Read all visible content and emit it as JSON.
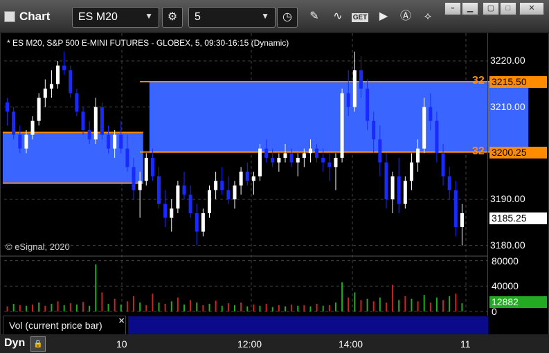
{
  "app": {
    "title": "Chart"
  },
  "toolbar": {
    "symbol": "ES M20",
    "interval": "5",
    "get_label": "GET"
  },
  "chart": {
    "caption": "* ES M20, S&P 500 E-MINI FUTURES - GLOBEX, 5, 09:30-16:15 (Dynamic)",
    "copyright": "© eSignal, 2020",
    "last_price": "3185.25",
    "level_count_label": "32"
  },
  "volume": {
    "legend": "Vol (current price bar)",
    "last_volume": "12882"
  },
  "footer": {
    "mode": "Dyn"
  },
  "colors": {
    "band": "#3a66ff",
    "level_line": "#ff8c00",
    "up": "#ffffff",
    "down": "#1a2aff",
    "vol_up": "#22aa22",
    "vol_down": "#cc2222"
  },
  "chart_data": {
    "type": "candlestick",
    "price_axis": {
      "ticks": [
        3220,
        3210,
        3190,
        3180
      ],
      "tick_labels": [
        "3220.00",
        "3210.00",
        "3190.00",
        "3180.00"
      ],
      "range": [
        3178,
        3226
      ]
    },
    "time_axis": {
      "ticks": [
        "10",
        "12:00",
        "14:00",
        "11"
      ]
    },
    "levels": [
      {
        "value": 3215.5,
        "label": "3215.50",
        "count": "32"
      },
      {
        "value": 3200.25,
        "label": "3200.25",
        "count": "32"
      }
    ],
    "bands": [
      {
        "from_bar": 0,
        "to_bar": 21,
        "low": 3193.5,
        "high": 3204.5
      },
      {
        "from_bar": 23,
        "to_bar": 82,
        "low": 3200.25,
        "high": 3215.5
      }
    ],
    "volume_axis": {
      "ticks": [
        80000,
        40000,
        0
      ],
      "tick_labels": [
        "80000",
        "40000",
        "0"
      ],
      "range": [
        0,
        85000
      ]
    },
    "candles": [
      [
        3211,
        3212,
        3206,
        3209
      ],
      [
        3209,
        3210,
        3203,
        3204
      ],
      [
        3204,
        3206,
        3200,
        3201
      ],
      [
        3201,
        3205,
        3200,
        3204
      ],
      [
        3204,
        3208,
        3203,
        3207
      ],
      [
        3207,
        3213,
        3206,
        3212
      ],
      [
        3212,
        3216,
        3210,
        3214
      ],
      [
        3214,
        3218,
        3212,
        3215
      ],
      [
        3215,
        3220,
        3214,
        3219
      ],
      [
        3219,
        3222,
        3217,
        3218
      ],
      [
        3218,
        3219,
        3212,
        3213
      ],
      [
        3213,
        3214,
        3208,
        3209
      ],
      [
        3209,
        3210,
        3204,
        3205
      ],
      [
        3205,
        3207,
        3202,
        3203
      ],
      [
        3203,
        3212,
        3202,
        3210
      ],
      [
        3210,
        3211,
        3203,
        3204
      ],
      [
        3204,
        3206,
        3200,
        3201
      ],
      [
        3201,
        3205,
        3199,
        3204
      ],
      [
        3204,
        3207,
        3200,
        3201
      ],
      [
        3201,
        3204,
        3196,
        3197
      ],
      [
        3197,
        3199,
        3190,
        3192
      ],
      [
        3192,
        3196,
        3186,
        3194
      ],
      [
        3194,
        3200,
        3193,
        3199
      ],
      [
        3199,
        3201,
        3194,
        3195
      ],
      [
        3195,
        3197,
        3188,
        3189
      ],
      [
        3189,
        3192,
        3184,
        3186
      ],
      [
        3186,
        3190,
        3183,
        3188
      ],
      [
        3188,
        3194,
        3187,
        3193
      ],
      [
        3193,
        3196,
        3190,
        3191
      ],
      [
        3191,
        3193,
        3186,
        3187
      ],
      [
        3187,
        3189,
        3180,
        3183
      ],
      [
        3183,
        3188,
        3182,
        3187
      ],
      [
        3187,
        3193,
        3186,
        3192
      ],
      [
        3192,
        3196,
        3190,
        3194
      ],
      [
        3194,
        3197,
        3191,
        3192
      ],
      [
        3192,
        3195,
        3189,
        3190
      ],
      [
        3190,
        3194,
        3188,
        3193
      ],
      [
        3193,
        3197,
        3191,
        3196
      ],
      [
        3196,
        3198,
        3193,
        3194
      ],
      [
        3194,
        3196,
        3191,
        3195
      ],
      [
        3195,
        3202,
        3194,
        3201
      ],
      [
        3201,
        3203,
        3198,
        3199
      ],
      [
        3199,
        3201,
        3197,
        3198
      ],
      [
        3198,
        3200,
        3196,
        3199
      ],
      [
        3199,
        3202,
        3198,
        3200
      ],
      [
        3200,
        3201,
        3197,
        3198
      ],
      [
        3198,
        3200,
        3195,
        3199
      ],
      [
        3199,
        3201,
        3197,
        3200
      ],
      [
        3200,
        3203,
        3198,
        3201
      ],
      [
        3201,
        3202,
        3198,
        3199
      ],
      [
        3199,
        3201,
        3196,
        3198
      ],
      [
        3198,
        3200,
        3194,
        3197
      ],
      [
        3197,
        3200,
        3192,
        3199
      ],
      [
        3199,
        3214,
        3198,
        3213
      ],
      [
        3213,
        3218,
        3208,
        3210
      ],
      [
        3210,
        3222,
        3209,
        3218
      ],
      [
        3218,
        3221,
        3212,
        3214
      ],
      [
        3214,
        3216,
        3205,
        3207
      ],
      [
        3207,
        3209,
        3200,
        3203
      ],
      [
        3203,
        3206,
        3195,
        3198
      ],
      [
        3198,
        3200,
        3188,
        3190
      ],
      [
        3190,
        3196,
        3187,
        3195
      ],
      [
        3195,
        3199,
        3187,
        3189
      ],
      [
        3189,
        3195,
        3188,
        3194
      ],
      [
        3194,
        3200,
        3192,
        3198
      ],
      [
        3198,
        3203,
        3196,
        3201
      ],
      [
        3201,
        3212,
        3200,
        3210
      ],
      [
        3210,
        3213,
        3205,
        3207
      ],
      [
        3207,
        3209,
        3198,
        3200
      ],
      [
        3200,
        3202,
        3193,
        3195
      ],
      [
        3195,
        3197,
        3190,
        3192
      ],
      [
        3192,
        3194,
        3182,
        3184
      ],
      [
        3184,
        3189,
        3180,
        3187
      ]
    ],
    "volumes": [
      [
        8000,
        "d"
      ],
      [
        12000,
        "u"
      ],
      [
        10000,
        "d"
      ],
      [
        9000,
        "u"
      ],
      [
        11000,
        "d"
      ],
      [
        14000,
        "u"
      ],
      [
        9000,
        "d"
      ],
      [
        12000,
        "u"
      ],
      [
        16000,
        "d"
      ],
      [
        10000,
        "u"
      ],
      [
        13000,
        "d"
      ],
      [
        11000,
        "u"
      ],
      [
        15000,
        "d"
      ],
      [
        9000,
        "u"
      ],
      [
        74000,
        "u"
      ],
      [
        30000,
        "d"
      ],
      [
        12000,
        "u"
      ],
      [
        20000,
        "d"
      ],
      [
        11000,
        "u"
      ],
      [
        16000,
        "d"
      ],
      [
        24000,
        "d"
      ],
      [
        14000,
        "u"
      ],
      [
        10000,
        "d"
      ],
      [
        28000,
        "d"
      ],
      [
        14000,
        "u"
      ],
      [
        12000,
        "d"
      ],
      [
        16000,
        "u"
      ],
      [
        22000,
        "d"
      ],
      [
        11000,
        "u"
      ],
      [
        18000,
        "d"
      ],
      [
        14000,
        "u"
      ],
      [
        10000,
        "d"
      ],
      [
        12000,
        "u"
      ],
      [
        17000,
        "d"
      ],
      [
        9000,
        "u"
      ],
      [
        13000,
        "d"
      ],
      [
        10000,
        "u"
      ],
      [
        14000,
        "d"
      ],
      [
        8000,
        "u"
      ],
      [
        11000,
        "d"
      ],
      [
        9000,
        "u"
      ],
      [
        12000,
        "d"
      ],
      [
        7000,
        "u"
      ],
      [
        10000,
        "d"
      ],
      [
        8000,
        "u"
      ],
      [
        11000,
        "d"
      ],
      [
        9000,
        "u"
      ],
      [
        10000,
        "d"
      ],
      [
        8000,
        "u"
      ],
      [
        12000,
        "d"
      ],
      [
        9000,
        "u"
      ],
      [
        10000,
        "d"
      ],
      [
        14000,
        "u"
      ],
      [
        46000,
        "u"
      ],
      [
        22000,
        "d"
      ],
      [
        30000,
        "u"
      ],
      [
        18000,
        "d"
      ],
      [
        20000,
        "u"
      ],
      [
        16000,
        "d"
      ],
      [
        22000,
        "u"
      ],
      [
        14000,
        "d"
      ],
      [
        42000,
        "d"
      ],
      [
        18000,
        "u"
      ],
      [
        24000,
        "d"
      ],
      [
        20000,
        "u"
      ],
      [
        16000,
        "d"
      ],
      [
        26000,
        "u"
      ],
      [
        14000,
        "d"
      ],
      [
        22000,
        "u"
      ],
      [
        18000,
        "d"
      ],
      [
        24000,
        "u"
      ],
      [
        28000,
        "d"
      ],
      [
        12882,
        "u"
      ]
    ]
  }
}
